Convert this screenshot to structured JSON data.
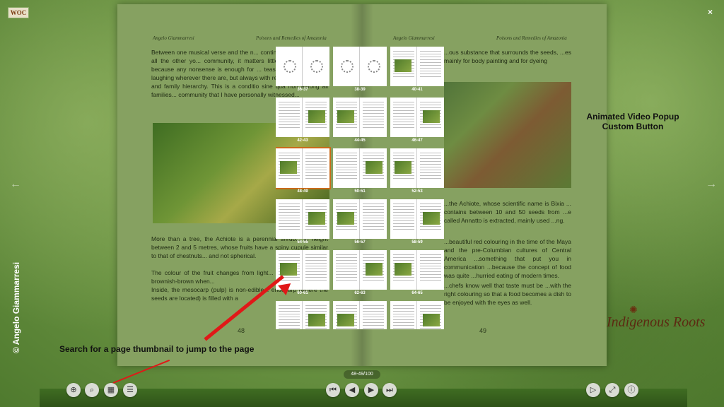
{
  "brand": {
    "logo_text": "WOC"
  },
  "window": {
    "close_label": "×"
  },
  "nav": {
    "prev_arrow": "←",
    "next_arrow": "→"
  },
  "copyright": "© Angelo Giammarresi",
  "book": {
    "left_page": {
      "header_author": "Angelo Giammarresi",
      "header_title": "Poisons and Remedies of Amazonia",
      "para1": "Between one musical verse and the n... continue to joke and, like all the other yo... community, it matters little that they alrea... because any nonsense is enough for ... teasing each other and laughing wherever there are, but always with respect for education and family hierarchy. This is a conditio sine qua non among all families... community that I have personally witnessed...",
      "para2": "More than a tree, the Achiote is a perennial shrub... in height between 2 and 5 metres, whose fruits have a spiny cupule similar to that of chestnuts... and not spherical.",
      "para3": "The colour of the fruit changes from light... burgundy-purple to brownish-brown when...",
      "para4": "Inside, the mesocarp (pulp) is non-edible... endocarp (where the seeds are located) is filled with a",
      "page_number": "48"
    },
    "right_page": {
      "header_author": "Angelo Giammarresi",
      "header_title": "Poisons and Remedies of Amazonia",
      "para1": "...ous substance that surrounds the seeds, ...es mainly for body painting and for dyeing",
      "para2": "...the Achiote, whose scientific name is Bixia ... contains between 10 and 50 seeds from ...e called Annatto is extracted, mainly used ...ng.",
      "para3": "...beautiful red colouring in the time of the Maya and the pre-Columbian cultures of Central America ...something that put you in communication ...because the concept of food was quite ...hurried eating of modern times.",
      "para4": "...chefs know well that taste must be ...with the right colouring so that a food becomes a dish to be enjoyed with the eyes as well.",
      "page_number": "49"
    }
  },
  "logo_roots": "Indigenous Roots",
  "annotations": {
    "popup": "Animated Video Popup Custom Button",
    "thumb": "Search for a page thumbnail to jump to the page"
  },
  "thumbnails": [
    {
      "label": "36-37",
      "state": "loading"
    },
    {
      "label": "38-39",
      "state": "loading"
    },
    {
      "label": "40-41",
      "state": "loaded"
    },
    {
      "label": "42-43",
      "state": "loaded"
    },
    {
      "label": "44-45",
      "state": "loaded"
    },
    {
      "label": "46-47",
      "state": "loaded"
    },
    {
      "label": "48-49",
      "state": "active"
    },
    {
      "label": "50-51",
      "state": "loaded"
    },
    {
      "label": "52-53",
      "state": "loaded"
    },
    {
      "label": "54-55",
      "state": "loaded"
    },
    {
      "label": "56-57",
      "state": "loaded"
    },
    {
      "label": "58-59",
      "state": "loaded"
    },
    {
      "label": "60-61",
      "state": "loaded"
    },
    {
      "label": "62-63",
      "state": "loaded"
    },
    {
      "label": "64-65",
      "state": "loaded"
    },
    {
      "label": "66-67",
      "state": "loaded"
    },
    {
      "label": "68-69",
      "state": "loaded"
    },
    {
      "label": "70-71",
      "state": "loaded"
    }
  ],
  "page_counter": "48-49/100",
  "toolbar": {
    "zoom_in": "⊕",
    "search": "⌕",
    "thumbnails": "▦",
    "toc": "☰",
    "first": "⏮",
    "prev": "◀",
    "next": "▶",
    "last": "⏭",
    "autoplay": "▷",
    "fullscreen": "⤢",
    "info": "ⓘ"
  },
  "colors": {
    "accent_arrow": "#e01818",
    "active_thumb": "#c96a1a"
  }
}
